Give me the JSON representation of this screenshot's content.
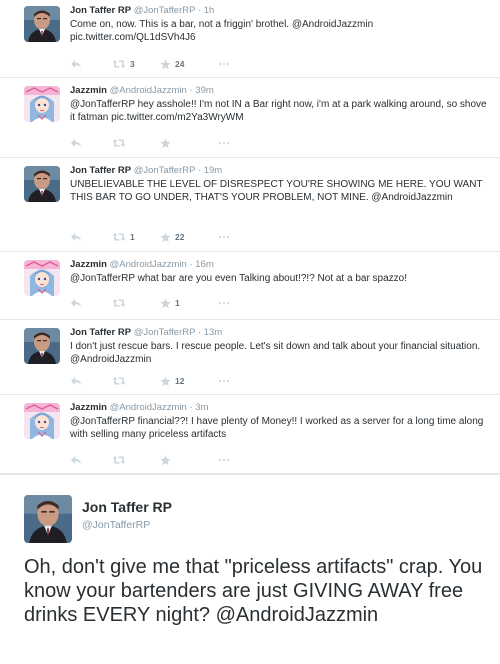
{
  "colors": {
    "text": "#292f33",
    "meta": "#8899a6",
    "divider": "#e1e8ed",
    "icon": "#ccd6dd"
  },
  "tweets": [
    {
      "name": "Jon Taffer RP",
      "handle": "@JonTafferRP",
      "time": "1h",
      "text": "Come on, now. This is a bar, not a friggin' brothel. @AndroidJazzmin pic.twitter.com/QL1dSVh4J6",
      "retweets": "3",
      "favorites": "24",
      "avatar": "jon-avatar"
    },
    {
      "name": "Jazzmin",
      "handle": "@AndroidJazzmin",
      "time": "39m",
      "text": "@JonTafferRP hey asshole!! I'm not IN a Bar right now, i'm at a park walking around, so shove it fatman pic.twitter.com/m2Ya3WryWM",
      "retweets": "",
      "favorites": "",
      "avatar": "jazzmin-avatar"
    },
    {
      "name": "Jon Taffer RP",
      "handle": "@JonTafferRP",
      "time": "19m",
      "text": "UNBELIEVABLE THE LEVEL OF DISRESPECT YOU'RE SHOWING ME HERE. YOU WANT THIS BAR TO GO UNDER, THAT'S YOUR PROBLEM, NOT MINE. @AndroidJazzmin",
      "retweets": "1",
      "favorites": "22",
      "avatar": "jon-avatar"
    },
    {
      "name": "Jazzmin",
      "handle": "@AndroidJazzmin",
      "time": "16m",
      "text": "@JonTafferRP what bar are you even Talking about!?!? Not at a bar spazzo!",
      "retweets": "",
      "favorites": "1",
      "avatar": "jazzmin-avatar"
    },
    {
      "name": "Jon Taffer RP",
      "handle": "@JonTafferRP",
      "time": "13m",
      "text": "I don't just rescue bars. I rescue people. Let's sit down and talk about your financial situation. @AndroidJazzmin",
      "retweets": "",
      "favorites": "12",
      "avatar": "jon-avatar"
    },
    {
      "name": "Jazzmin",
      "handle": "@AndroidJazzmin",
      "time": "3m",
      "text": "@JonTafferRP financial??! I have plenty of Money!! I worked as a server for a long time along with selling many priceless artifacts",
      "retweets": "",
      "favorites": "",
      "avatar": "jazzmin-avatar"
    }
  ],
  "expanded": {
    "name": "Jon Taffer RP",
    "handle": "@JonTafferRP",
    "text": "Oh, don't give me that \"priceless artifacts\" crap. You know your bartenders are just GIVING AWAY free drinks EVERY night? @AndroidJazzmin",
    "avatar": "jon-avatar"
  }
}
